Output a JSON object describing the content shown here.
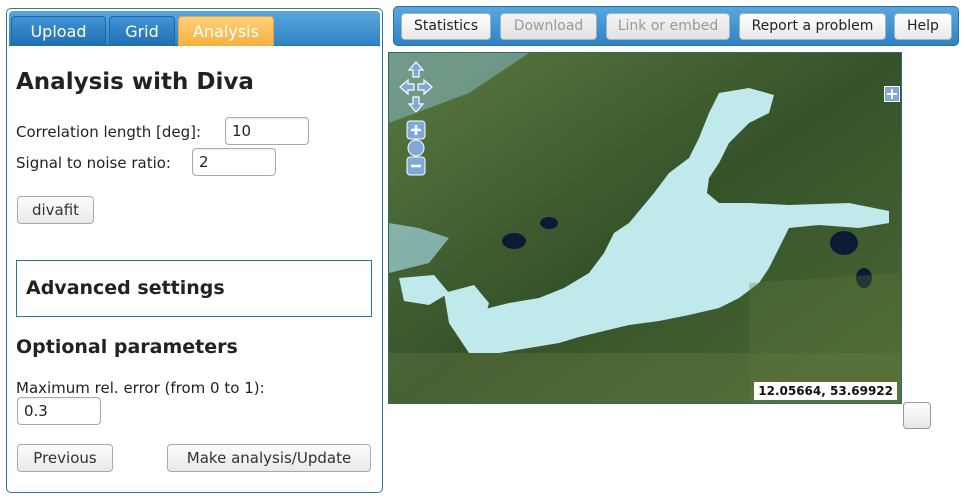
{
  "tabs": [
    {
      "label": "Upload",
      "active": false
    },
    {
      "label": "Grid",
      "active": false
    },
    {
      "label": "Analysis",
      "active": true
    }
  ],
  "analysis": {
    "title": "Analysis with Diva",
    "corr_label": "Correlation length [deg]:",
    "corr_value": "10",
    "snr_label": "Signal to noise ratio:",
    "snr_value": "2",
    "divafit_label": "divafit",
    "advanced_label": "Advanced settings",
    "optional_title": "Optional parameters",
    "max_err_label": "Maximum rel. error (from 0 to 1):",
    "max_err_value": "0.3",
    "previous_label": "Previous",
    "make_label": "Make analysis/Update"
  },
  "toolbar": {
    "statistics": "Statistics",
    "download": "Download",
    "link": "Link or embed",
    "report": "Report a problem",
    "help": "Help"
  },
  "map": {
    "coords": "12.05664, 53.69922",
    "sea_color": "#bfe9ea",
    "land_color": "#3e5a2b"
  }
}
